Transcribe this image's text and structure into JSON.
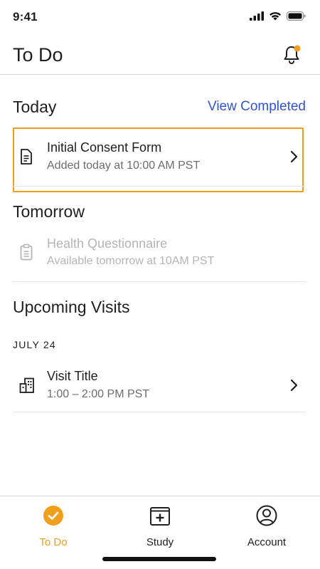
{
  "status_bar": {
    "time": "9:41"
  },
  "header": {
    "title": "To Do",
    "notification_dot_color": "#f09f1c"
  },
  "today": {
    "heading": "Today",
    "view_completed": "View Completed",
    "task": {
      "title": "Initial Consent Form",
      "subtitle": "Added today at 10:00 AM PST",
      "icon": "document-icon"
    }
  },
  "tomorrow": {
    "heading": "Tomorrow",
    "task": {
      "title": "Health Questionnaire",
      "subtitle": "Available tomorrow at 10AM PST",
      "icon": "clipboard-icon"
    }
  },
  "upcoming": {
    "heading": "Upcoming Visits",
    "date": "JULY 24",
    "visit": {
      "title": "Visit Title",
      "subtitle": "1:00 – 2:00 PM PST",
      "icon": "building-icon"
    }
  },
  "tabs": [
    {
      "label": "To Do",
      "icon": "check-circle-icon",
      "active": true
    },
    {
      "label": "Study",
      "icon": "medical-box-icon",
      "active": false
    },
    {
      "label": "Account",
      "icon": "user-circle-icon",
      "active": false
    }
  ],
  "colors": {
    "accent": "#f09f1c",
    "link": "#2f55d4",
    "text": "#1f1f1f",
    "muted": "#6d6d6d",
    "disabled": "#b5b5b5"
  }
}
